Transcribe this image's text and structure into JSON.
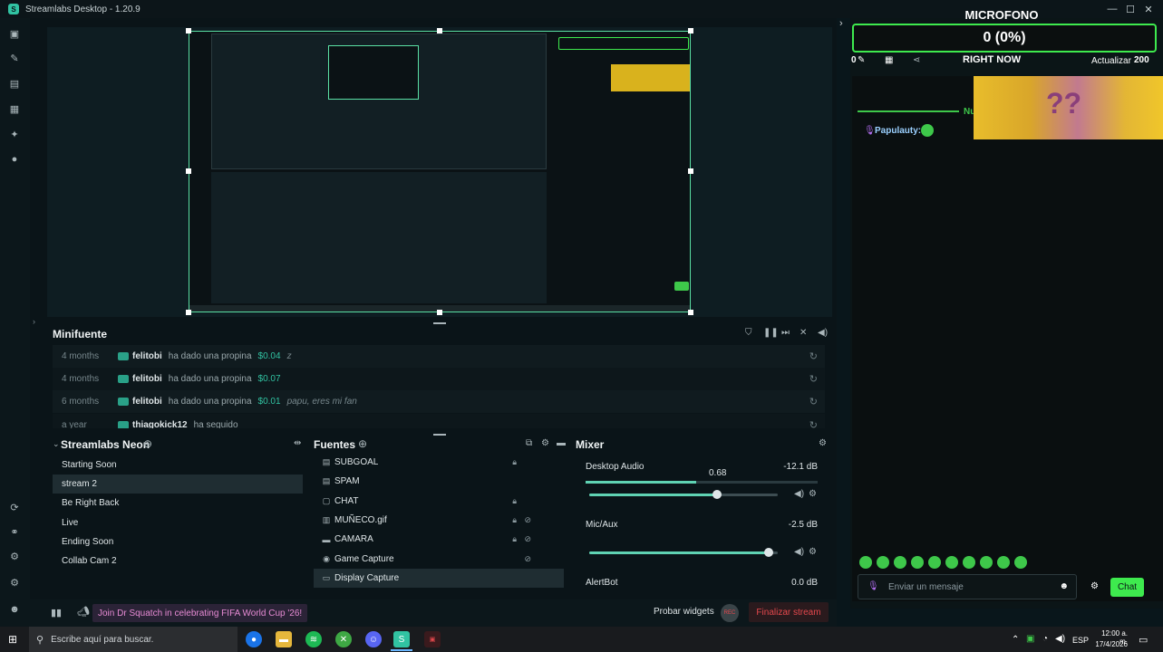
{
  "window": {
    "title": "Streamlabs Desktop - 1.20.9"
  },
  "window_controls": {
    "minimize": "—",
    "maximize": "☐",
    "close": "✕"
  },
  "nav_icons": [
    "studio-icon",
    "themes-icon",
    "store-icon",
    "layout-icon",
    "highlighter-icon",
    "record-icon",
    "dashboard-icon",
    "link-icon",
    "widget-icon",
    "settings-icon",
    "profile-icon"
  ],
  "minifuente": {
    "title": "Minifuente",
    "rows": [
      {
        "ago": "4 months",
        "name": "felitobi",
        "msg": "ha dado una propina",
        "amount": "$0.04",
        "note": "z"
      },
      {
        "ago": "4 months",
        "name": "felitobi",
        "msg": "ha dado una propina",
        "amount": "$0.07",
        "note": ""
      },
      {
        "ago": "6 months",
        "name": "felitobi",
        "msg": "ha dado una propina",
        "amount": "$0.01",
        "note": "papu, eres mi fan"
      },
      {
        "ago": "a year",
        "name": "thiagokick12",
        "msg": "ha seguido",
        "amount": "",
        "note": ""
      }
    ]
  },
  "scenes": {
    "title": "Streamlabs Neon",
    "items": [
      "Starting Soon",
      "stream 2",
      "Be Right Back",
      "Live",
      "Ending Soon",
      "Collab Cam 2"
    ],
    "active_index": 1
  },
  "sources": {
    "title": "Fuentes",
    "items": [
      "SUBGOAL",
      "SPAM",
      "CHAT",
      "MUÑECO.gif",
      "CAMARA",
      "Game Capture",
      "Display Capture"
    ],
    "active_index": 6
  },
  "mixer": {
    "title": "Mixer",
    "channels": [
      {
        "name": "Desktop Audio",
        "db": "-12.1 dB",
        "value_label": "0.68",
        "level": 0.68
      },
      {
        "name": "Mic/Aux",
        "db": "-2.5 dB",
        "value_label": "",
        "level": 0.95
      },
      {
        "name": "AlertBot",
        "db": "0.0 dB",
        "value_label": "",
        "level": 1.0
      }
    ]
  },
  "footer": {
    "banner": "Join Dr Squatch in celebrating FIFA World Cup '26!",
    "test_widgets": "Probar widgets",
    "rec_badge": "REC",
    "end_stream": "Finalizar stream"
  },
  "right_panel": {
    "mic_title": "MICROFONO",
    "mic_value": "0 (0%)",
    "left_counter": "0",
    "right_now": "RIGHT NOW",
    "update": "Actualizar",
    "update_value": "200",
    "divider_label": "Nu",
    "chat_user": "Papulauty:",
    "input_placeholder": "Enviar un mensaje",
    "chat_button": "Chat"
  },
  "taskbar": {
    "search_placeholder": "Escribe aquí para buscar.",
    "lang": "ESP",
    "time": "12:00 a. m.",
    "date": "17/4/2026"
  },
  "colors": {
    "accent": "#31c3a2",
    "mic_border": "#3eea4e",
    "banner_text": "#e78bd4",
    "end_stream": "#e5484d"
  }
}
